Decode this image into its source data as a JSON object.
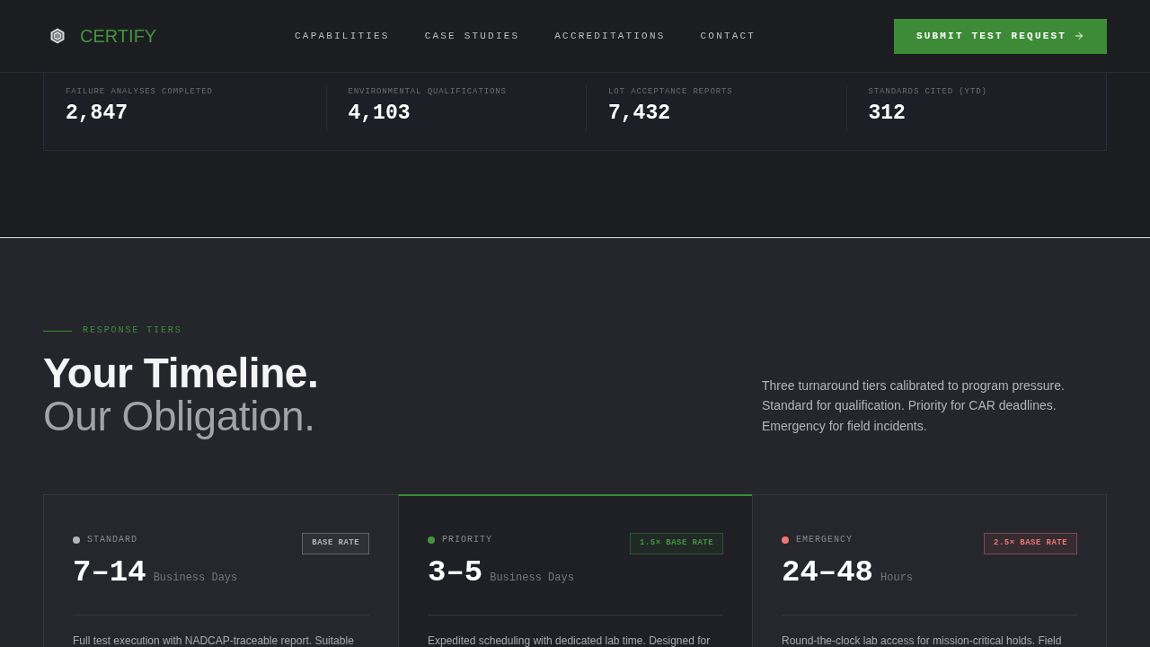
{
  "header": {
    "logo": "CERTIFY",
    "nav": [
      "CAPABILITIES",
      "CASE STUDIES",
      "ACCREDITATIONS",
      "CONTACT"
    ],
    "cta": "SUBMIT TEST REQUEST"
  },
  "stats": [
    {
      "label": "FAILURE ANALYSES COMPLETED",
      "value": "2,847"
    },
    {
      "label": "ENVIRONMENTAL QUALIFICATIONS",
      "value": "4,103"
    },
    {
      "label": "LOT ACCEPTANCE REPORTS",
      "value": "7,432"
    },
    {
      "label": "STANDARDS CITED (YTD)",
      "value": "312"
    }
  ],
  "tiers_section": {
    "eyebrow": "RESPONSE TIERS",
    "heading": "Your Timeline.",
    "subheading": "Our Obligation.",
    "intro": "Three turnaround tiers calibrated to program pressure. Standard for qualification. Priority for CAR deadlines. Emergency for field incidents.",
    "tiers": [
      {
        "name": "STANDARD",
        "color": "#b5b5b8",
        "badge": "BASE RATE",
        "range": "7–14",
        "unit": "Business Days",
        "description": "Full test execution with NADCAP-traceable report. Suitable",
        "selected": false
      },
      {
        "name": "PRIORITY",
        "color": "#43953e",
        "badge": "1.5× BASE RATE",
        "range": "3–5",
        "unit": "Business Days",
        "description": "Expedited scheduling with dedicated lab time. Designed for",
        "selected": true
      },
      {
        "name": "EMERGENCY",
        "color": "#f07575",
        "badge": "2.5× BASE RATE",
        "range": "24–48",
        "unit": "Hours",
        "description": "Round-the-clock lab access for mission-critical holds. Field",
        "selected": false
      }
    ]
  }
}
